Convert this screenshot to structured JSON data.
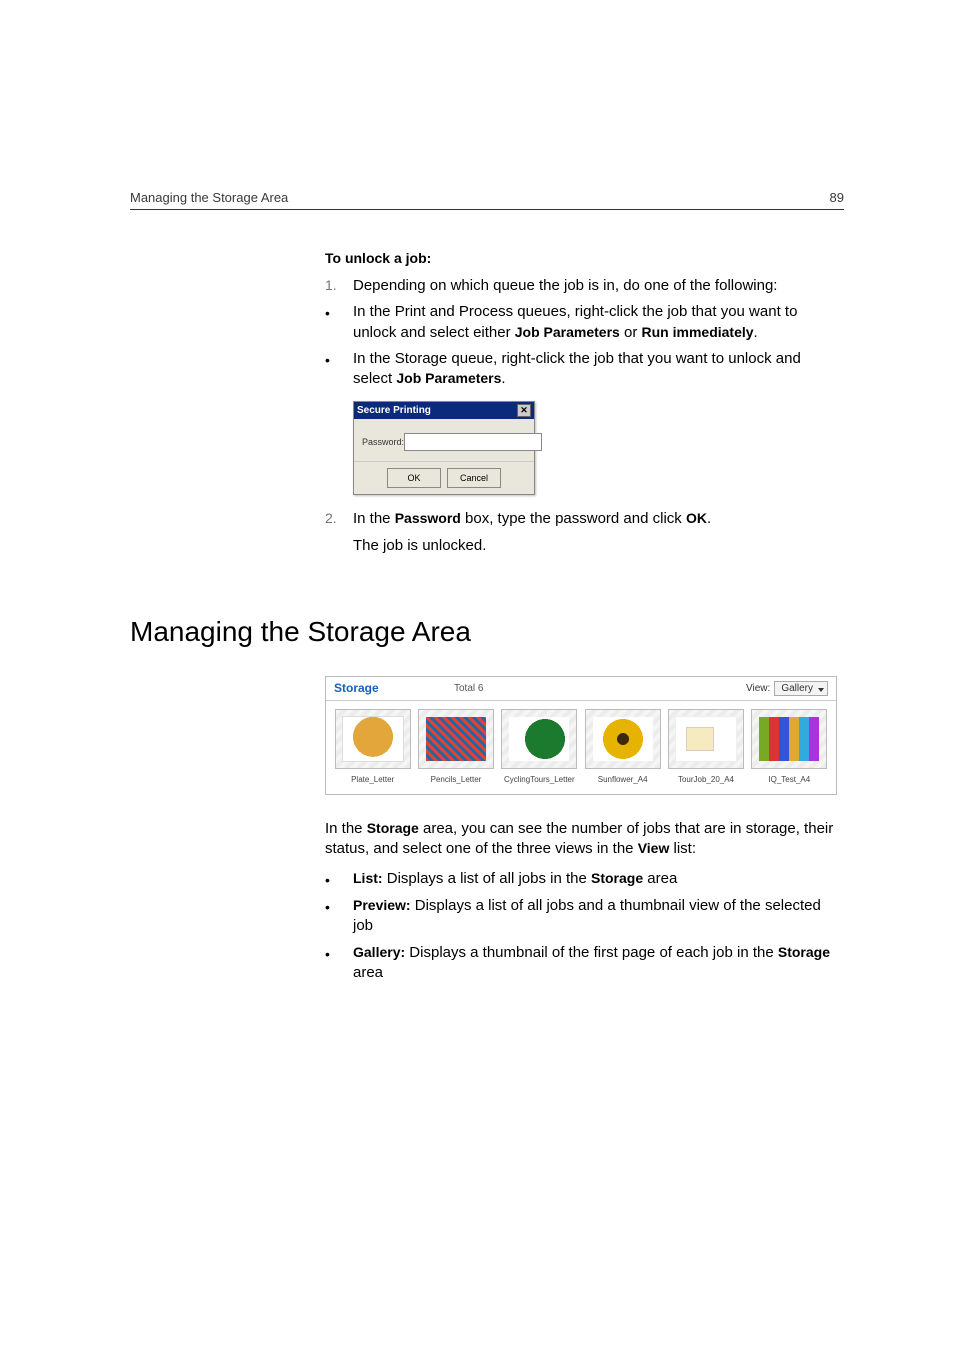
{
  "header": {
    "left": "Managing the Storage Area",
    "right": "89"
  },
  "unlock": {
    "heading": "To unlock a job:",
    "step1_num": "1.",
    "step1": "Depending on which queue the job is in, do one of the following:",
    "bullet1_pre": "In the Print and Process queues, right-click the job that you want to unlock and select either ",
    "bullet1_b1": "Job Parameters",
    "bullet1_mid": " or ",
    "bullet1_b2": "Run immediately",
    "bullet1_post": ".",
    "bullet2_pre": "In the Storage queue, right-click the job that you want to unlock and select ",
    "bullet2_b": "Job Parameters",
    "bullet2_post": ".",
    "step2_num": "2.",
    "step2_pre": "In the ",
    "step2_b1": "Password",
    "step2_mid": " box, type the password and click ",
    "step2_b2": "OK",
    "step2_post": ".",
    "step2_result": "The job is unlocked."
  },
  "dialog": {
    "title": "Secure Printing",
    "password_label": "Password:",
    "ok": "OK",
    "cancel": "Cancel"
  },
  "section_title": "Managing the Storage Area",
  "gallery": {
    "title": "Storage",
    "total": "Total 6",
    "view_label": "View:",
    "view_value": "Gallery",
    "items": [
      "Plate_Letter",
      "Pencils_Letter",
      "CyclingTours_Letter",
      "Sunflower_A4",
      "TourJob_20_A4",
      "IQ_Test_A4"
    ]
  },
  "storage_desc": {
    "pre": "In the ",
    "b1": "Storage",
    "mid": " area, you can see the number of jobs that are in storage, their status, and select one of the three views in the ",
    "b2": "View",
    "post": " list:",
    "li1_b": "List:",
    "li1_mid": " Displays a list of all jobs in the ",
    "li1_b2": "Storage",
    "li1_post": " area",
    "li2_b": "Preview:",
    "li2": " Displays a list of all jobs and a thumbnail view of the selected job",
    "li3_b": "Gallery:",
    "li3_mid": " Displays a thumbnail of the first page of each job in the ",
    "li3_b2": "Storage",
    "li3_post": " area"
  }
}
